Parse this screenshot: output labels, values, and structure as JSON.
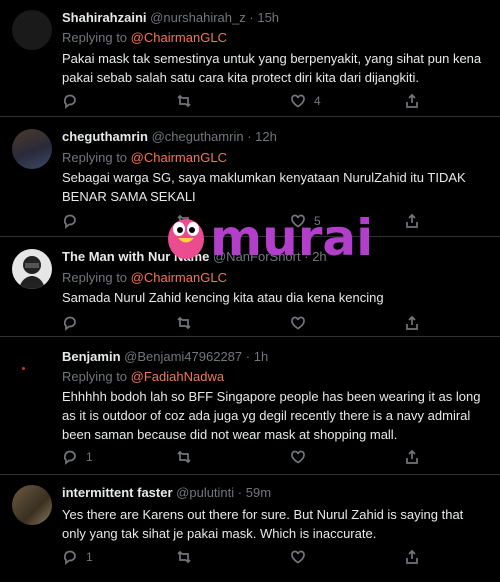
{
  "tweets": [
    {
      "name": "Shahirahzaini",
      "handle": "@nurshahirah_z",
      "time": "15h",
      "replying_prefix": "Replying to",
      "replying_to": "@ChairmanGLC",
      "text_lines": [
        "Pakai mask tak semestinya untuk yang berpenyakit, yang sihat pun kena",
        "pakai sebab salah satu cara kita protect diri kita dari dijangkiti."
      ],
      "reply_count": "",
      "retweet_count": "",
      "like_count": "4"
    },
    {
      "name": "cheguthamrin",
      "handle": "@cheguthamrin",
      "time": "12h",
      "replying_prefix": "Replying to",
      "replying_to": "@ChairmanGLC",
      "text_lines": [
        "Sebagai warga SG, saya maklumkan kenyataan NurulZahid itu TIDAK",
        "BENAR SAMA SEKALI"
      ],
      "reply_count": "",
      "retweet_count": "",
      "like_count": "5"
    },
    {
      "name": "The Man with Nur Name",
      "handle": "@NanForShort",
      "time": "2h",
      "replying_prefix": "Replying to",
      "replying_to": "@ChairmanGLC",
      "text_lines": [
        "Samada Nurul Zahid kencing kita atau dia kena kencing"
      ],
      "reply_count": "",
      "retweet_count": "",
      "like_count": ""
    },
    {
      "name": "Benjamin",
      "handle": "@Benjami47962287",
      "time": "1h",
      "replying_prefix": "Replying to",
      "replying_to": "@FadiahNadwa",
      "text_lines": [
        "Ehhhhh bodoh lah so BFF Singapore people has been wearing it as long",
        "as it is outdoor of coz ada juga yg degil recently there is a navy admiral",
        "been saman because did not wear mask at shopping mall."
      ],
      "reply_count": "1",
      "retweet_count": "",
      "like_count": ""
    },
    {
      "name": "intermittent faster",
      "handle": "@pulutinti",
      "time": "59m",
      "replying_prefix": "",
      "replying_to": "",
      "text_lines": [
        "Yes there are Karens out there for sure. But Nurul Zahid is saying that",
        "only yang tak sihat je pakai mask. Which is inaccurate."
      ],
      "reply_count": "1",
      "retweet_count": "",
      "like_count": ""
    }
  ],
  "watermark": {
    "text": "murai",
    "color": "#b13fc9"
  },
  "separator": "·"
}
